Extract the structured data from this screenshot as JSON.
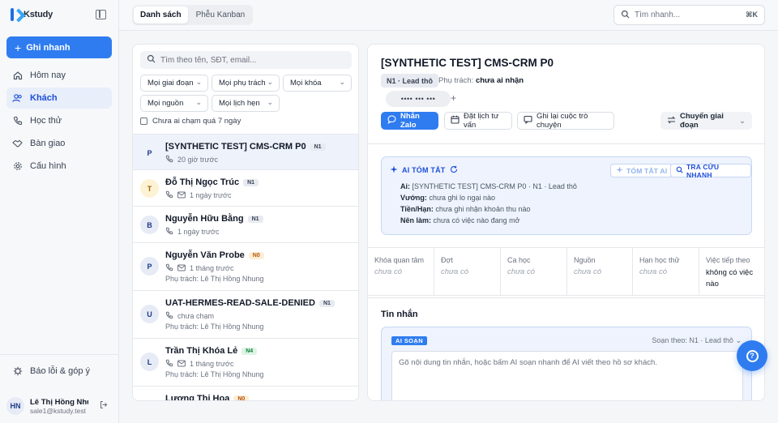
{
  "brand": {
    "name": "Kstudy"
  },
  "sidebar": {
    "quick_add": "Ghi nhanh",
    "items": [
      {
        "label": "Hôm nay",
        "icon": "home-icon"
      },
      {
        "label": "Khách",
        "icon": "users-icon",
        "active": true
      },
      {
        "label": "Học thử",
        "icon": "phone-icon"
      },
      {
        "label": "Bàn giao",
        "icon": "handshake-icon"
      },
      {
        "label": "Cấu hình",
        "icon": "gear-icon"
      }
    ],
    "report": "Báo lỗi & góp ý",
    "user": {
      "initials": "HN",
      "name": "Lê Thị Hồng Nhung",
      "email": "sale1@kstudy.test"
    }
  },
  "topbar": {
    "tabs": [
      "Danh sách",
      "Phễu Kanban"
    ],
    "search_placeholder": "Tìm nhanh...",
    "shortcut": "⌘K"
  },
  "list": {
    "search_placeholder": "Tìm theo tên, SĐT, email...",
    "filters": [
      "Mọi giai đoạn",
      "Mọi phụ trách",
      "Mọi khóa",
      "Mọi nguồn",
      "Mọi lịch hẹn"
    ],
    "untouched_label": "Chưa ai chạm quá 7 ngày",
    "rows": [
      {
        "initial": "P",
        "name": "[SYNTHETIC TEST] CMS-CRM P0",
        "badge": "N1",
        "meta": "20 giờ trước",
        "owner": ""
      },
      {
        "initial": "T",
        "name": "Đỗ Thị Ngọc Trúc",
        "badge": "N1",
        "meta": "1 ngày trước",
        "owner": ""
      },
      {
        "initial": "B",
        "name": "Nguyễn Hữu Bằng",
        "badge": "N1",
        "meta": "1 ngày trước",
        "owner": ""
      },
      {
        "initial": "P",
        "name": "Nguyễn Văn Probe",
        "badge": "N0",
        "meta": "1 tháng trước",
        "owner": "Phụ trách: Lê Thị Hồng Nhung"
      },
      {
        "initial": "U",
        "name": "UAT-HERMES-READ-SALE-DENIED",
        "badge": "N1",
        "meta": "chưa chạm",
        "owner": "Phụ trách: Lê Thị Hồng Nhung"
      },
      {
        "initial": "L",
        "name": "Trần Thị Khóa Lẻ",
        "badge": "N4",
        "meta": "1 tháng trước",
        "owner": "Phụ trách: Lê Thị Hồng Nhung"
      },
      {
        "initial": "",
        "name": "Lương Thị Hoa",
        "badge": "N0",
        "meta": "",
        "owner": ""
      }
    ]
  },
  "detail": {
    "title": "[SYNTHETIC TEST] CMS-CRM P0",
    "stage": "N1 · Lead thô",
    "owner_label": "Phụ trách:",
    "owner_value": "chưa ai nhận",
    "phone_masked": "•••• ••• •••",
    "actions": {
      "zalo": "Nhắn Zalo",
      "schedule": "Đặt lịch tư vấn",
      "log": "Ghi lại cuộc trò chuyện",
      "stage": "Chuyển giai đoạn"
    },
    "ai": {
      "heading": "AI TÓM TẮT",
      "summarize_btn": "TÓM TẮT AI",
      "lookup_btn": "TRA CỨU NHANH",
      "lines": [
        {
          "k": "Ai:",
          "v": "[SYNTHETIC TEST] CMS-CRM P0 · N1 · Lead thô"
        },
        {
          "k": "Vướng:",
          "v": "chưa ghi lo ngại nào"
        },
        {
          "k": "Tiền/Hạn:",
          "v": "chưa ghi nhận khoản thu nào"
        },
        {
          "k": "Nên làm:",
          "v": "chưa có việc nào đang mở"
        }
      ]
    },
    "fields": [
      {
        "label": "Khóa quan tâm",
        "value": "chưa có"
      },
      {
        "label": "Đợt",
        "value": "chưa có"
      },
      {
        "label": "Ca học",
        "value": "chưa có"
      },
      {
        "label": "Nguồn",
        "value": "chưa có"
      },
      {
        "label": "Hạn học thử",
        "value": "chưa có"
      },
      {
        "label": "Việc tiếp theo",
        "value": "không có việc nào"
      }
    ],
    "messages_title": "Tin nhắn",
    "compose": {
      "tag": "AI SOẠN",
      "meta": "Soạn theo: N1 · Lead thô",
      "placeholder": "Gõ nội dung tin nhắn, hoặc bấm AI soạn nhanh để AI viết theo hồ sơ khách."
    }
  },
  "colors": {
    "accent": "#2f7cf0",
    "selected_row": "#eef2fb",
    "ai_card": "#eef3fd"
  }
}
